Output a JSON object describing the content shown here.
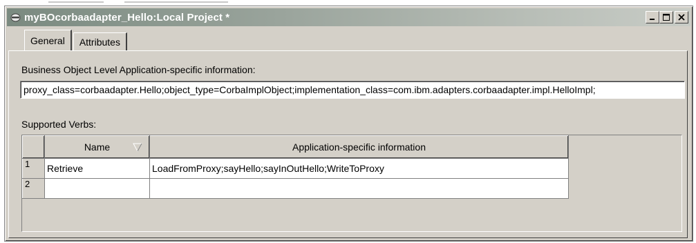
{
  "window": {
    "title": "myBOcorbaadapter_Hello:Local Project *",
    "title_icon": "database-icon",
    "controls": [
      "minimize-icon",
      "maximize-icon",
      "close-icon"
    ]
  },
  "tabs": [
    {
      "label": "General",
      "active": true
    },
    {
      "label": "Attributes",
      "active": false
    }
  ],
  "general": {
    "bo_label": "Business Object Level Application-specific information:",
    "bo_value": "proxy_class=corbaadapter.Hello;object_type=CorbaImplObject;implementation_class=com.ibm.adapters.corbaadapter.impl.HelloImpl;",
    "verbs_label": "Supported Verbs:"
  },
  "verbs_table": {
    "headers": [
      "Name",
      "Application-specific information"
    ],
    "sort_icon": "sort-down-icon",
    "rows": [
      {
        "num": "1",
        "name": "Retrieve",
        "info": "LoadFromProxy;sayHello;sayInOutHello;WriteToProxy"
      },
      {
        "num": "2",
        "name": "",
        "info": ""
      }
    ]
  },
  "colors": {
    "face": "#d4d0c8",
    "title_gradient_start": "#7a8a80",
    "title_gradient_end": "#c8ccc6"
  }
}
